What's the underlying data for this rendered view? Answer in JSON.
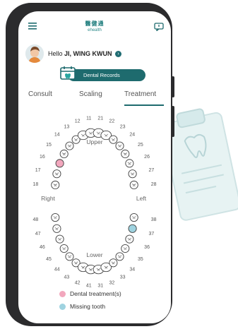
{
  "brand": {
    "name_zh": "醫健通",
    "name_en": "ehealth"
  },
  "greeting": {
    "prefix": "Hello",
    "name": "JI, WING KWUN"
  },
  "records_button": {
    "label": "Dental Records"
  },
  "tabs": [
    {
      "label": "Consult"
    },
    {
      "label": "Scaling"
    },
    {
      "label": "Treatment",
      "selected": true
    }
  ],
  "jaw": {
    "upper_label": "Upper",
    "lower_label": "Lower",
    "right_label": "Right",
    "left_label": "Left",
    "upper_teeth": [
      {
        "num": "18",
        "status": "normal"
      },
      {
        "num": "17",
        "status": "normal"
      },
      {
        "num": "16",
        "status": "treatment"
      },
      {
        "num": "15",
        "status": "normal"
      },
      {
        "num": "14",
        "status": "normal"
      },
      {
        "num": "13",
        "status": "normal"
      },
      {
        "num": "12",
        "status": "normal"
      },
      {
        "num": "11",
        "status": "normal"
      },
      {
        "num": "21",
        "status": "normal"
      },
      {
        "num": "22",
        "status": "normal"
      },
      {
        "num": "23",
        "status": "normal"
      },
      {
        "num": "24",
        "status": "normal"
      },
      {
        "num": "25",
        "status": "normal"
      },
      {
        "num": "26",
        "status": "normal"
      },
      {
        "num": "27",
        "status": "normal"
      },
      {
        "num": "28",
        "status": "normal"
      }
    ],
    "lower_teeth": [
      {
        "num": "48",
        "status": "normal"
      },
      {
        "num": "47",
        "status": "normal"
      },
      {
        "num": "46",
        "status": "normal"
      },
      {
        "num": "45",
        "status": "normal"
      },
      {
        "num": "44",
        "status": "normal"
      },
      {
        "num": "43",
        "status": "normal"
      },
      {
        "num": "42",
        "status": "normal"
      },
      {
        "num": "41",
        "status": "normal"
      },
      {
        "num": "31",
        "status": "normal"
      },
      {
        "num": "32",
        "status": "normal"
      },
      {
        "num": "33",
        "status": "normal"
      },
      {
        "num": "34",
        "status": "normal"
      },
      {
        "num": "35",
        "status": "normal"
      },
      {
        "num": "36",
        "status": "normal"
      },
      {
        "num": "37",
        "status": "missing"
      },
      {
        "num": "38",
        "status": "normal"
      }
    ]
  },
  "legend": [
    {
      "label": "Dental treatment(s)",
      "color": "#f2a7bd"
    },
    {
      "label": "Missing tooth",
      "color": "#9fd3e0"
    }
  ],
  "colors": {
    "accent": "#1e6b6e",
    "treatment": "#f2a7bd",
    "missing": "#9fd3e0"
  },
  "icons": [
    "menu-icon",
    "message-icon",
    "dental-records-icon",
    "clipboard-icon",
    "avatar"
  ]
}
